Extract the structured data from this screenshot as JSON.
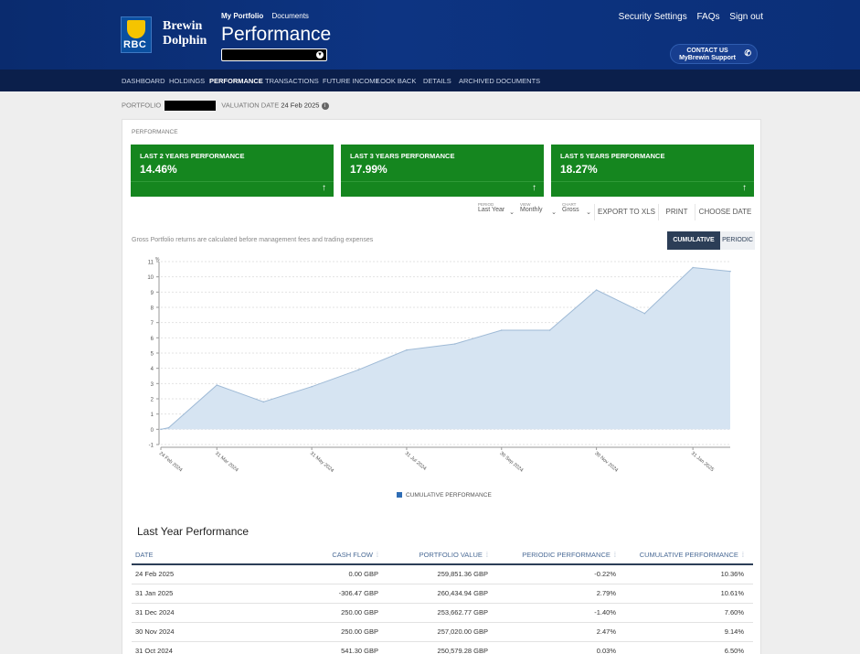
{
  "header": {
    "logo_text": "RBC",
    "brand_line1": "Brewin",
    "brand_line2": "Dolphin",
    "top_links": [
      "My Portfolio",
      "Documents"
    ],
    "page_title": "Performance",
    "right_links": [
      "Security Settings",
      "FAQs",
      "Sign out"
    ],
    "contact_line1": "CONTACT US",
    "contact_line2": "MyBrewin Support"
  },
  "nav": {
    "items": [
      "DASHBOARD",
      "HOLDINGS",
      "PERFORMANCE",
      "TRANSACTIONS",
      "FUTURE INCOME",
      "LOOK BACK",
      "DETAILS",
      "ARCHIVED DOCUMENTS"
    ],
    "active": "PERFORMANCE"
  },
  "info": {
    "portfolio_label": "PORTFOLIO",
    "valuation_label": "VALUATION DATE",
    "valuation_date": "24 Feb 2025"
  },
  "performance": {
    "section_label": "PERFORMANCE",
    "boxes": [
      {
        "label": "LAST 2 YEARS PERFORMANCE",
        "value": "14.46%"
      },
      {
        "label": "LAST 3 YEARS PERFORMANCE",
        "value": "17.99%"
      },
      {
        "label": "LAST 5 YEARS PERFORMANCE",
        "value": "18.27%"
      }
    ],
    "controls": [
      {
        "caption": "PERIOD",
        "value": "Last Year"
      },
      {
        "caption": "VIEW",
        "value": "Monthly"
      },
      {
        "caption": "CHART",
        "value": "Gross"
      }
    ],
    "actions": [
      "EXPORT TO XLS",
      "PRINT",
      "CHOOSE DATE"
    ],
    "disclaimer": "Gross Portfolio returns are calculated before management fees and trading expenses",
    "toggle_on": "CUMULATIVE",
    "toggle_off": "PERIODIC",
    "legend": "CUMULATIVE PERFORMANCE",
    "table_title": "Last Year Performance"
  },
  "colors": {
    "header": "#0d3482",
    "nav": "#0b1f4b",
    "green": "#15861f",
    "area_fill": "#d6e4f2",
    "area_line": "#9fbad6"
  },
  "chart_data": {
    "type": "area",
    "y_unit": "%",
    "x": [
      "24 Feb 2024",
      "29 Feb 2024",
      "31 Mar 2024",
      "30 Apr 2024",
      "31 May 2024",
      "30 Jun 2024",
      "31 Jul 2024",
      "31 Aug 2024",
      "30 Sep 2024",
      "31 Oct 2024",
      "30 Nov 2024",
      "31 Dec 2024",
      "31 Jan 2025",
      "24 Feb 2025"
    ],
    "x_tick_labels": [
      "24 Feb 2024",
      "31 Mar 2024",
      "31 May 2024",
      "31 Jul 2024",
      "30 Sep 2024",
      "30 Nov 2024",
      "31 Jan 2025"
    ],
    "series": [
      {
        "name": "CUMULATIVE PERFORMANCE",
        "values": [
          0,
          0.1,
          2.9,
          1.8,
          2.8,
          3.9,
          5.2,
          5.6,
          6.5,
          6.5,
          9.14,
          7.6,
          10.61,
          10.36
        ]
      }
    ],
    "ylim": [
      -1,
      11
    ],
    "yticks": [
      -1,
      0,
      1,
      2,
      3,
      4,
      5,
      6,
      7,
      8,
      9,
      10,
      11
    ],
    "grid": true
  },
  "table": {
    "headers": [
      "DATE",
      "CASH FLOW",
      "PORTFOLIO VALUE",
      "PERIODIC PERFORMANCE",
      "CUMULATIVE PERFORMANCE"
    ],
    "rows": [
      [
        "24 Feb 2025",
        "0.00 GBP",
        "259,851.36 GBP",
        "-0.22%",
        "10.36%"
      ],
      [
        "31 Jan 2025",
        "-306.47 GBP",
        "260,434.94 GBP",
        "2.79%",
        "10.61%"
      ],
      [
        "31 Dec 2024",
        "250.00 GBP",
        "253,662.77 GBP",
        "-1.40%",
        "7.60%"
      ],
      [
        "30 Nov 2024",
        "250.00 GBP",
        "257,020.00 GBP",
        "2.47%",
        "9.14%"
      ],
      [
        "31 Oct 2024",
        "541.30 GBP",
        "250,579.28 GBP",
        "0.03%",
        "6.50%"
      ]
    ]
  }
}
